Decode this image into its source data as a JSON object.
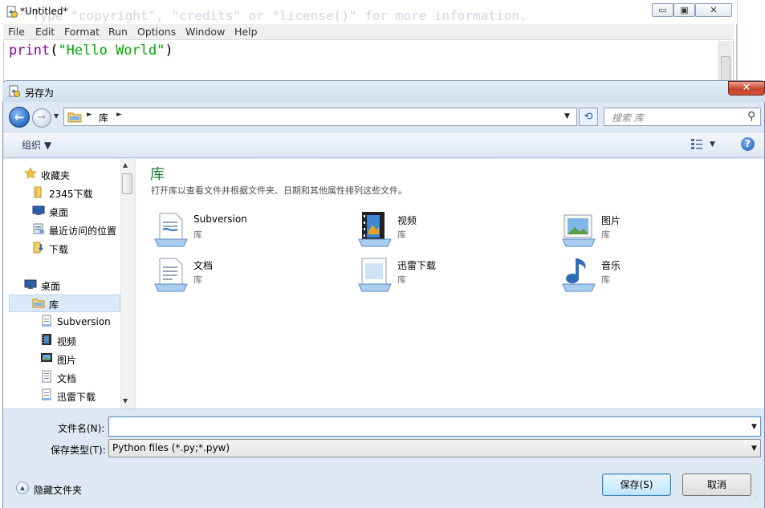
{
  "idle": {
    "title": "*Untitled*",
    "ghost_text": "Type \"copyright\", \"credits\" or \"license()\" for more information.",
    "caption": {
      "minimize": "▭",
      "maximize": "▣",
      "close": "✕"
    },
    "menu": [
      "File",
      "Edit",
      "Format",
      "Run",
      "Options",
      "Window",
      "Help"
    ],
    "code": {
      "keyword": "print",
      "open": "(",
      "string": "\"Hello World\"",
      "close": ")"
    }
  },
  "dialog": {
    "title": "另存为",
    "close_glyph": "✕",
    "nav": {
      "back": "←",
      "forward": "→",
      "recent": "▼"
    },
    "address": {
      "sep": "►",
      "crumb": "库",
      "drop": "▼"
    },
    "refresh_glyph": "⟲",
    "search": {
      "placeholder": "搜索 库",
      "icon": "⚲"
    },
    "toolbar": {
      "organize": "组织 ▼",
      "view_drop": "▼",
      "help": "?"
    },
    "nav_pane": {
      "scroll_up": "▲",
      "scroll_down": "▼",
      "items": [
        {
          "label": "收藏夹",
          "icon": "star-icon"
        },
        {
          "label": "2345下载",
          "icon": "folder-icon"
        },
        {
          "label": "桌面",
          "icon": "desktop-icon"
        },
        {
          "label": "最近访问的位置",
          "icon": "recent-places-icon"
        },
        {
          "label": "下载",
          "icon": "download-folder-icon"
        },
        {
          "label": "桌面",
          "icon": "desktop-icon"
        },
        {
          "label": "库",
          "icon": "library-icon"
        },
        {
          "label": "Subversion",
          "icon": "document-library-icon"
        },
        {
          "label": "视频",
          "icon": "video-icon"
        },
        {
          "label": "图片",
          "icon": "picture-icon"
        },
        {
          "label": "文档",
          "icon": "document-icon"
        },
        {
          "label": "迅雷下载",
          "icon": "document-library-icon"
        }
      ]
    },
    "content": {
      "title": "库",
      "description": "打开库以查看文件并根据文件夹、日期和其他属性排列这些文件。",
      "libraries": [
        {
          "name": "Subversion",
          "type": "库",
          "icon": "subversion-library-icon"
        },
        {
          "name": "视频",
          "type": "库",
          "icon": "video-library-icon"
        },
        {
          "name": "图片",
          "type": "库",
          "icon": "picture-library-icon"
        },
        {
          "name": "文档",
          "type": "库",
          "icon": "document-library-icon"
        },
        {
          "name": "迅雷下载",
          "type": "库",
          "icon": "download-library-icon"
        },
        {
          "name": "音乐",
          "type": "库",
          "icon": "music-library-icon"
        }
      ]
    },
    "form": {
      "filename_label": "文件名(N):",
      "filename_value": "",
      "filename_drop": "▼",
      "filetype_label": "保存类型(T):",
      "filetype_value": "Python files (*.py;*.pyw)",
      "filetype_drop": "▼",
      "hide_folders_glyph": "▲",
      "hide_folders": "隐藏文件夹",
      "save": "保存(S)",
      "cancel": "取消",
      "grip": "⋰"
    }
  }
}
